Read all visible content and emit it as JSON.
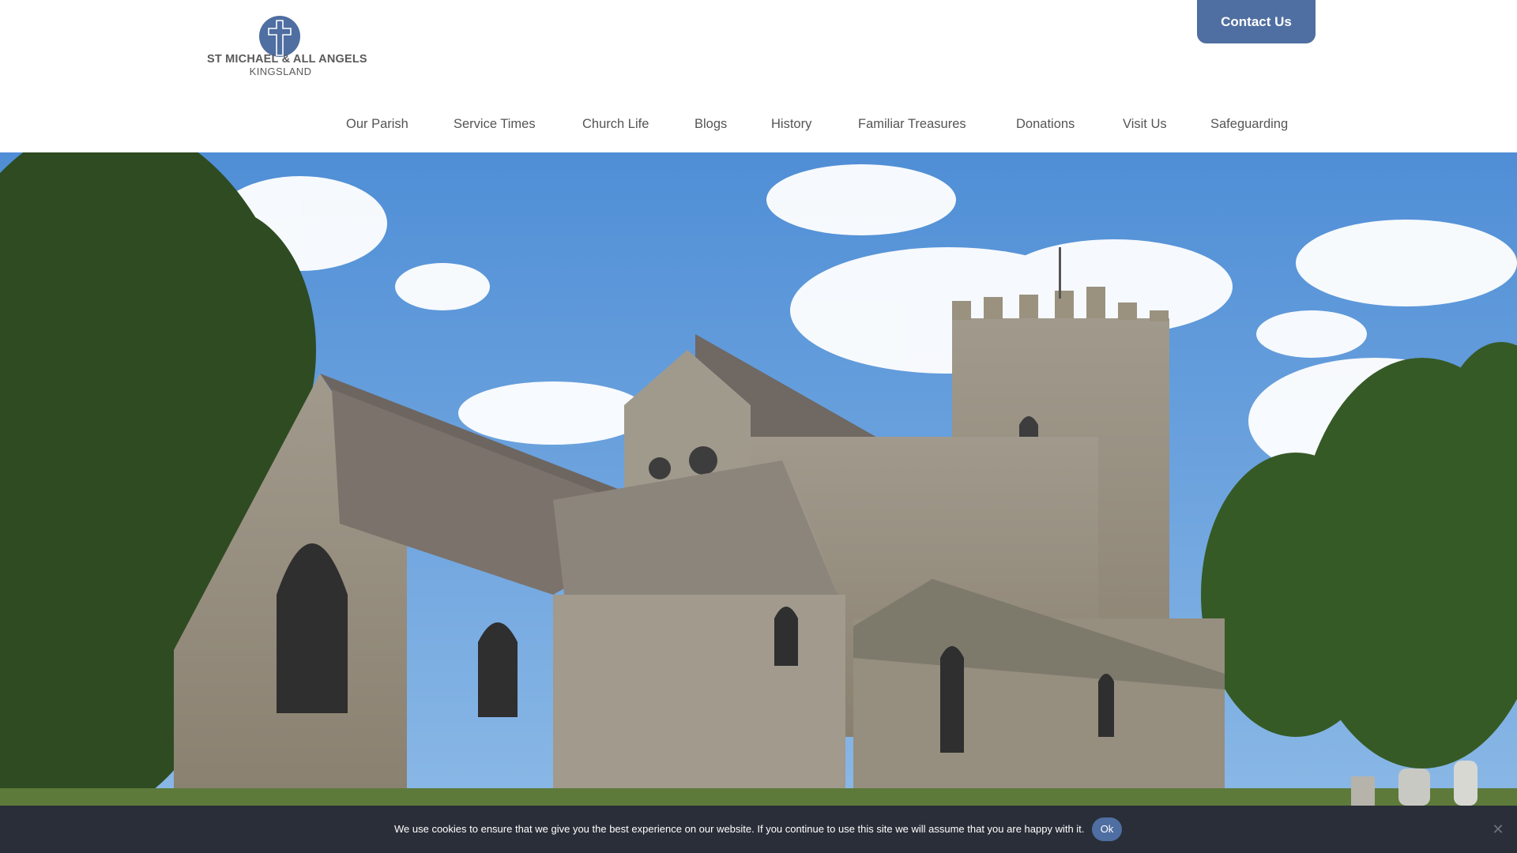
{
  "brand": {
    "line1": "ST MICHAEL & ALL ANGELS",
    "line2": "KINGSLAND",
    "color": "#4f6ea1"
  },
  "header": {
    "contact_label": "Contact Us"
  },
  "nav": {
    "items": [
      {
        "label": "Our Parish"
      },
      {
        "label": "Service Times"
      },
      {
        "label": "Church Life"
      },
      {
        "label": "Blogs"
      },
      {
        "label": "History"
      },
      {
        "label": "Familiar Treasures"
      },
      {
        "label": "Donations"
      },
      {
        "label": "Visit Us"
      },
      {
        "label": "Safeguarding"
      }
    ]
  },
  "hero": {
    "icon": "church-photo"
  },
  "cookie": {
    "message": "We use cookies to ensure that we give you the best experience on our website. If you continue to use this site we will assume that you are happy with it.",
    "ok_label": "Ok",
    "close_icon": "close-icon"
  }
}
